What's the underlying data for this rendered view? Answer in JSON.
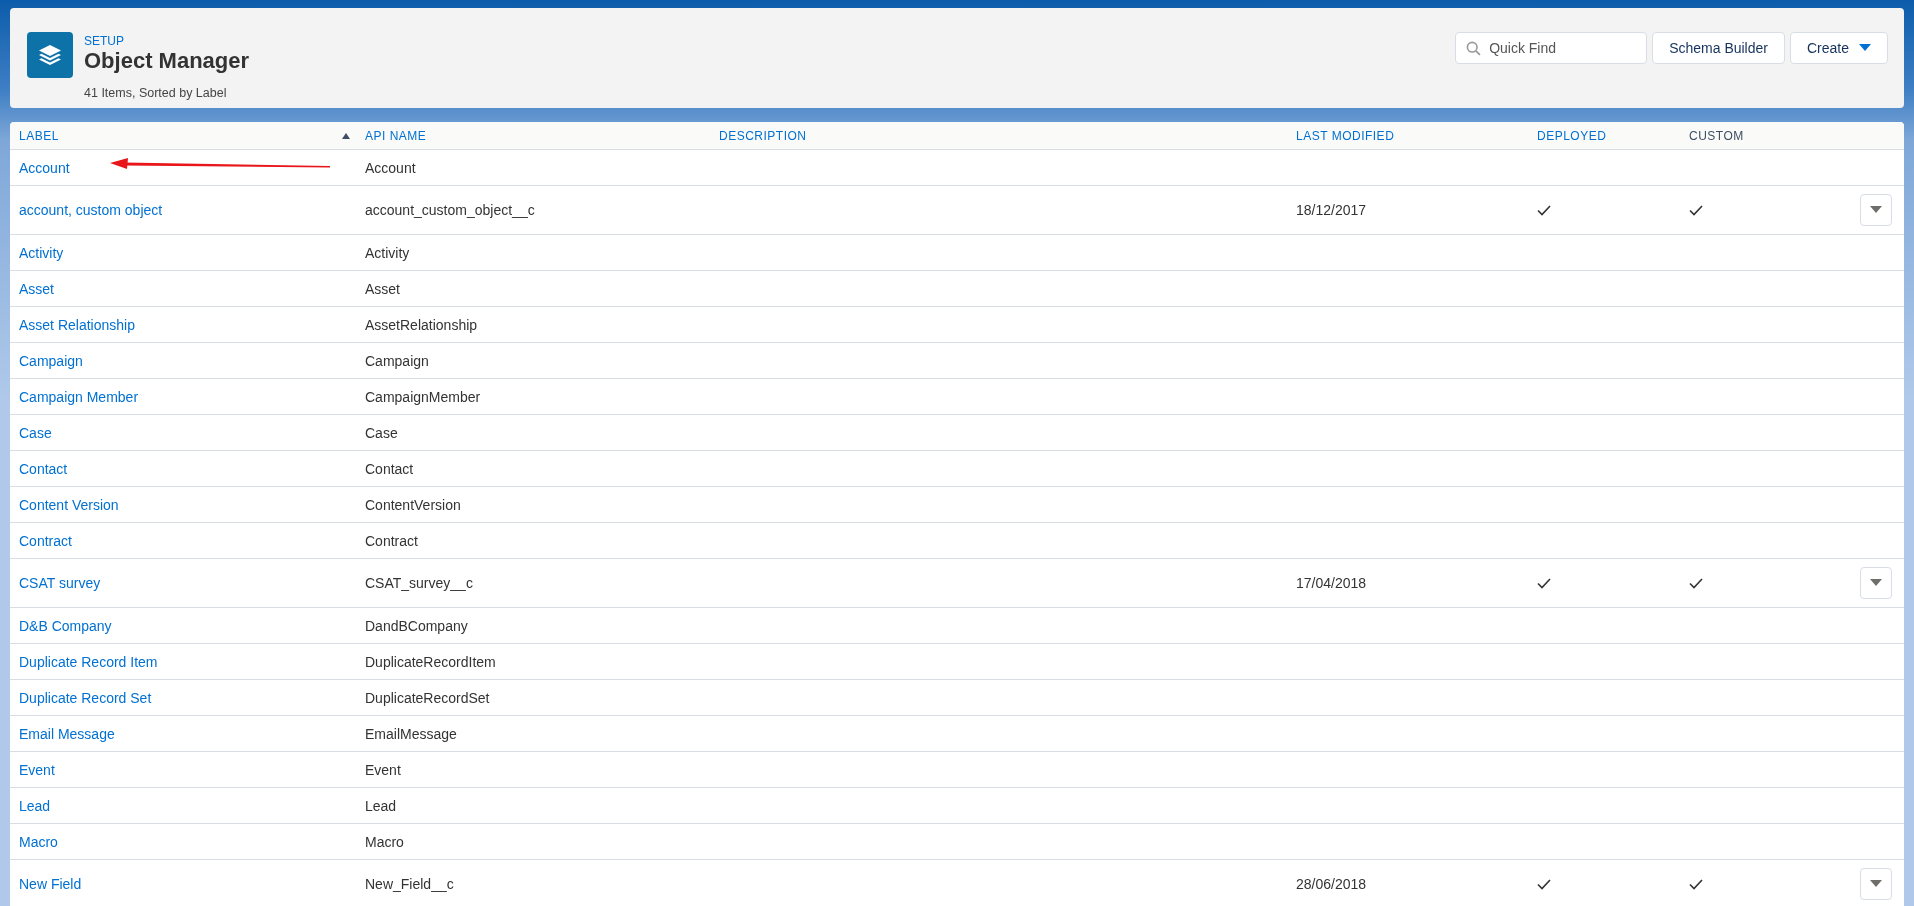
{
  "header": {
    "breadcrumb": "SETUP",
    "title": "Object Manager",
    "subtitle": "41 Items, Sorted by Label",
    "search": {
      "placeholder": "Quick Find"
    },
    "buttons": [
      {
        "label": "Schema Builder",
        "kind": "plain"
      },
      {
        "label": "Create",
        "kind": "menu"
      }
    ]
  },
  "table": {
    "columns": [
      {
        "label": "LABEL",
        "sortable": true,
        "sorted": true
      },
      {
        "label": "API NAME",
        "sortable": true,
        "sorted": false
      },
      {
        "label": "DESCRIPTION",
        "sortable": true,
        "sorted": false
      },
      {
        "label": "LAST MODIFIED",
        "sortable": true,
        "sorted": false
      },
      {
        "label": "DEPLOYED",
        "sortable": true,
        "sorted": false
      },
      {
        "label": "CUSTOM",
        "sortable": false,
        "sorted": false
      }
    ],
    "rows": [
      {
        "label": "Account",
        "api_name": "Account",
        "deployed": false,
        "custom": false,
        "actions": false
      },
      {
        "label": "account, custom object",
        "api_name": "account_custom_object__c",
        "last_modified": "18/12/2017",
        "deployed": true,
        "custom": true,
        "actions": true
      },
      {
        "label": "Activity",
        "api_name": "Activity",
        "deployed": false,
        "custom": false,
        "actions": false
      },
      {
        "label": "Asset",
        "api_name": "Asset",
        "deployed": false,
        "custom": false,
        "actions": false
      },
      {
        "label": "Asset Relationship",
        "api_name": "AssetRelationship",
        "deployed": false,
        "custom": false,
        "actions": false
      },
      {
        "label": "Campaign",
        "api_name": "Campaign",
        "deployed": false,
        "custom": false,
        "actions": false
      },
      {
        "label": "Campaign Member",
        "api_name": "CampaignMember",
        "deployed": false,
        "custom": false,
        "actions": false
      },
      {
        "label": "Case",
        "api_name": "Case",
        "deployed": false,
        "custom": false,
        "actions": false
      },
      {
        "label": "Contact",
        "api_name": "Contact",
        "deployed": false,
        "custom": false,
        "actions": false
      },
      {
        "label": "Content Version",
        "api_name": "ContentVersion",
        "deployed": false,
        "custom": false,
        "actions": false
      },
      {
        "label": "Contract",
        "api_name": "Contract",
        "deployed": false,
        "custom": false,
        "actions": false
      },
      {
        "label": "CSAT survey",
        "api_name": "CSAT_survey__c",
        "last_modified": "17/04/2018",
        "deployed": true,
        "custom": true,
        "actions": true
      },
      {
        "label": "D&B Company",
        "api_name": "DandBCompany",
        "deployed": false,
        "custom": false,
        "actions": false
      },
      {
        "label": "Duplicate Record Item",
        "api_name": "DuplicateRecordItem",
        "deployed": false,
        "custom": false,
        "actions": false
      },
      {
        "label": "Duplicate Record Set",
        "api_name": "DuplicateRecordSet",
        "deployed": false,
        "custom": false,
        "actions": false
      },
      {
        "label": "Email Message",
        "api_name": "EmailMessage",
        "deployed": false,
        "custom": false,
        "actions": false
      },
      {
        "label": "Event",
        "api_name": "Event",
        "deployed": false,
        "custom": false,
        "actions": false
      },
      {
        "label": "Lead",
        "api_name": "Lead",
        "deployed": false,
        "custom": false,
        "actions": false
      },
      {
        "label": "Macro",
        "api_name": "Macro",
        "deployed": false,
        "custom": false,
        "actions": false
      },
      {
        "label": "New Field",
        "api_name": "New_Field__c",
        "last_modified": "28/06/2018",
        "deployed": true,
        "custom": true,
        "actions": true
      }
    ]
  }
}
